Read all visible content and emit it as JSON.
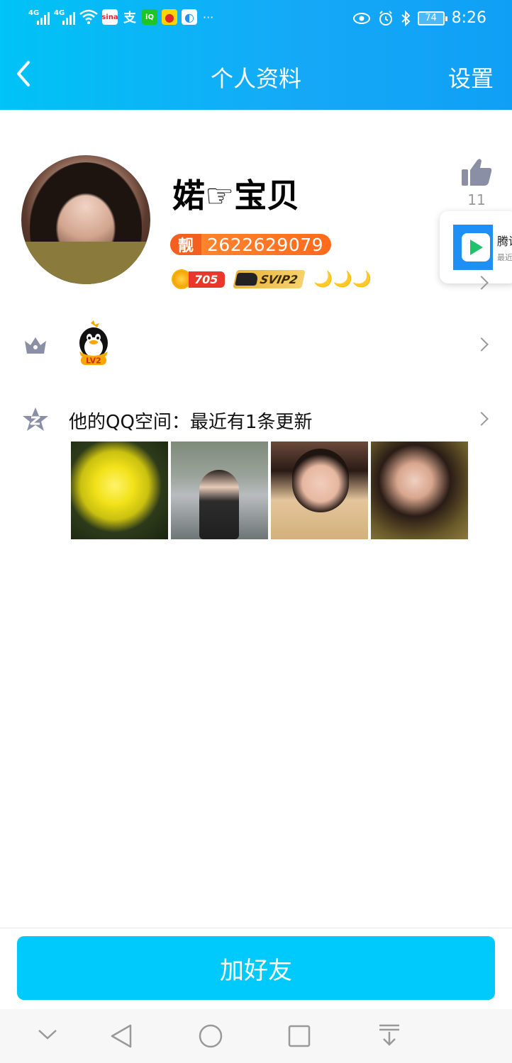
{
  "status_bar": {
    "signal1_label": "4G",
    "signal2_label": "4G",
    "apps": [
      "sina",
      "支",
      "iQIY",
      "weibo",
      "qq-browser"
    ],
    "more": "···",
    "battery": "74",
    "time": "8:26"
  },
  "header": {
    "title": "个人资料",
    "settings_label": "设置"
  },
  "profile": {
    "nickname": "婼☞宝贝",
    "liang_tag": "靓",
    "qq_number": "2622629079",
    "coin_value": "705",
    "svip_label": "SVIP2",
    "moons": "🌙🌙🌙",
    "like_count": "11"
  },
  "popup": {
    "title": "腾讯",
    "subtitle": "最近"
  },
  "level": {
    "badge": "LV2"
  },
  "qzone": {
    "text": "他的QQ空间：最近有1条更新"
  },
  "actions": {
    "add_friend": "加好友"
  },
  "colors": {
    "header_gradient_start": "#00c3f6",
    "header_gradient_end": "#15a8f7",
    "button": "#00cafc",
    "qq_id_badge": "#ff6a1c"
  }
}
